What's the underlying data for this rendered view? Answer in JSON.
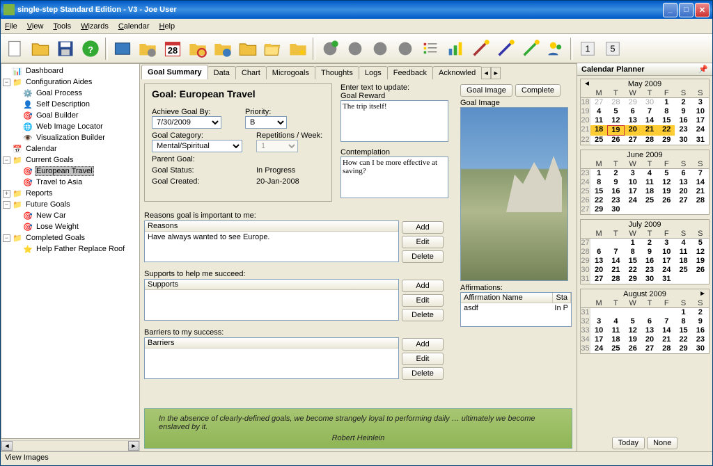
{
  "window": {
    "title": "single-step Standard Edition - V3 - Joe User"
  },
  "menu": [
    "File",
    "View",
    "Tools",
    "Wizards",
    "Calendar",
    "Help"
  ],
  "tree": {
    "dashboard": "Dashboard",
    "config_aides": "Configuration Aides",
    "goal_process": "Goal Process",
    "self_desc": "Self Description",
    "goal_builder": "Goal Builder",
    "web_img": "Web Image Locator",
    "viz_builder": "Visualization Builder",
    "calendar": "Calendar",
    "current_goals": "Current Goals",
    "european": "European Travel",
    "asia": "Travel to Asia",
    "reports": "Reports",
    "future_goals": "Future Goals",
    "new_car": "New Car",
    "lose_weight": "Lose Weight",
    "completed": "Completed Goals",
    "help_father": "Help Father Replace Roof"
  },
  "tabs": [
    "Goal Summary",
    "Data",
    "Chart",
    "Microgoals",
    "Thoughts",
    "Logs",
    "Feedback",
    "Acknowled"
  ],
  "goal": {
    "title": "Goal: European Travel",
    "achieve_by_lbl": "Achieve Goal By:",
    "achieve_by": "7/30/2009",
    "priority_lbl": "Priority:",
    "priority": "B",
    "category_lbl": "Goal Category:",
    "category": "Mental/Spiritual",
    "reps_lbl": "Repetitions / Week:",
    "reps": "1",
    "parent_lbl": "Parent Goal:",
    "status_lbl": "Goal Status:",
    "status": "In Progress",
    "created_lbl": "Goal Created:",
    "created": "20-Jan-2008"
  },
  "mid": {
    "enter_text": "Enter text to update:",
    "reward_lbl": "Goal Reward",
    "reward": "The trip itself!",
    "contemp_lbl": "Contemplation",
    "contemp": "How can I be more effective at saving?"
  },
  "right": {
    "goal_image_btn": "Goal Image",
    "complete_btn": "Complete",
    "goal_image_lbl": "Goal Image",
    "affirm_lbl": "Affirmations:",
    "aff_col1": "Affirmation Name",
    "aff_col2": "Sta",
    "aff_row1_name": "asdf",
    "aff_row1_status": "In P"
  },
  "sections": {
    "reasons_lbl": "Reasons goal is important to me:",
    "reasons_hdr": "Reasons",
    "reasons_body": "Have always wanted to see Europe.",
    "supports_lbl": "Supports to help me succeed:",
    "supports_hdr": "Supports",
    "barriers_lbl": "Barriers to my success:",
    "barriers_hdr": "Barriers",
    "add": "Add",
    "edit": "Edit",
    "delete": "Delete"
  },
  "quote": {
    "text": "In the absence of clearly-defined goals, we become strangely loyal to performing daily … ultimately we become enslaved by it.",
    "author": "Robert Heinlein"
  },
  "calendar": {
    "title": "Calendar Planner",
    "today": "Today",
    "none": "None",
    "dow": [
      "M",
      "T",
      "W",
      "T",
      "F",
      "S",
      "S"
    ],
    "months": [
      {
        "name": "May 2009",
        "weeks": [
          {
            "wn": "18",
            "days": [
              [
                "27",
                true
              ],
              [
                "28",
                true
              ],
              [
                "29",
                true
              ],
              [
                "30",
                true
              ],
              [
                "1",
                false
              ],
              [
                "2",
                false
              ],
              [
                "3",
                false
              ]
            ]
          },
          {
            "wn": "19",
            "days": [
              [
                "4",
                false
              ],
              [
                "5",
                false
              ],
              [
                "6",
                false
              ],
              [
                "7",
                false
              ],
              [
                "8",
                false
              ],
              [
                "9",
                false
              ],
              [
                "10",
                false
              ]
            ]
          },
          {
            "wn": "20",
            "days": [
              [
                "11",
                false
              ],
              [
                "12",
                false
              ],
              [
                "13",
                false
              ],
              [
                "14",
                false
              ],
              [
                "15",
                false
              ],
              [
                "16",
                false
              ],
              [
                "17",
                false
              ]
            ]
          },
          {
            "wn": "21",
            "days": [
              [
                "18",
                false,
                "hl"
              ],
              [
                "19",
                false,
                "hl today"
              ],
              [
                "20",
                false,
                "hl"
              ],
              [
                "21",
                false,
                "hl"
              ],
              [
                "22",
                false,
                "hl"
              ],
              [
                "23",
                false
              ],
              [
                "24",
                false
              ]
            ]
          },
          {
            "wn": "22",
            "days": [
              [
                "25",
                false
              ],
              [
                "26",
                false
              ],
              [
                "27",
                false
              ],
              [
                "28",
                false
              ],
              [
                "29",
                false
              ],
              [
                "30",
                false
              ],
              [
                "31",
                false
              ]
            ]
          }
        ]
      },
      {
        "name": "June 2009",
        "weeks": [
          {
            "wn": "23",
            "days": [
              [
                "1",
                false
              ],
              [
                "2",
                false
              ],
              [
                "3",
                false
              ],
              [
                "4",
                false
              ],
              [
                "5",
                false
              ],
              [
                "6",
                false
              ],
              [
                "7",
                false
              ]
            ]
          },
          {
            "wn": "24",
            "days": [
              [
                "8",
                false
              ],
              [
                "9",
                false
              ],
              [
                "10",
                false
              ],
              [
                "11",
                false
              ],
              [
                "12",
                false
              ],
              [
                "13",
                false
              ],
              [
                "14",
                false
              ]
            ]
          },
          {
            "wn": "25",
            "days": [
              [
                "15",
                false
              ],
              [
                "16",
                false
              ],
              [
                "17",
                false
              ],
              [
                "18",
                false
              ],
              [
                "19",
                false
              ],
              [
                "20",
                false
              ],
              [
                "21",
                false
              ]
            ]
          },
          {
            "wn": "26",
            "days": [
              [
                "22",
                false
              ],
              [
                "23",
                false
              ],
              [
                "24",
                false
              ],
              [
                "25",
                false
              ],
              [
                "26",
                false
              ],
              [
                "27",
                false
              ],
              [
                "28",
                false
              ]
            ]
          },
          {
            "wn": "27",
            "days": [
              [
                "29",
                false
              ],
              [
                "30",
                false
              ],
              [
                "",
                true
              ],
              [
                "",
                true
              ],
              [
                "",
                true
              ],
              [
                "",
                true
              ],
              [
                "",
                true
              ]
            ]
          }
        ]
      },
      {
        "name": "July 2009",
        "weeks": [
          {
            "wn": "27",
            "days": [
              [
                "",
                true
              ],
              [
                "",
                true
              ],
              [
                "1",
                false
              ],
              [
                "2",
                false
              ],
              [
                "3",
                false
              ],
              [
                "4",
                false
              ],
              [
                "5",
                false
              ]
            ]
          },
          {
            "wn": "28",
            "days": [
              [
                "6",
                false
              ],
              [
                "7",
                false
              ],
              [
                "8",
                false
              ],
              [
                "9",
                false
              ],
              [
                "10",
                false
              ],
              [
                "11",
                false
              ],
              [
                "12",
                false
              ]
            ]
          },
          {
            "wn": "29",
            "days": [
              [
                "13",
                false
              ],
              [
                "14",
                false
              ],
              [
                "15",
                false
              ],
              [
                "16",
                false
              ],
              [
                "17",
                false
              ],
              [
                "18",
                false
              ],
              [
                "19",
                false
              ]
            ]
          },
          {
            "wn": "30",
            "days": [
              [
                "20",
                false
              ],
              [
                "21",
                false
              ],
              [
                "22",
                false
              ],
              [
                "23",
                false
              ],
              [
                "24",
                false
              ],
              [
                "25",
                false
              ],
              [
                "26",
                false
              ]
            ]
          },
          {
            "wn": "31",
            "days": [
              [
                "27",
                false
              ],
              [
                "28",
                false
              ],
              [
                "29",
                false
              ],
              [
                "30",
                false
              ],
              [
                "31",
                false
              ],
              [
                "",
                true
              ],
              [
                "",
                true
              ]
            ]
          }
        ]
      },
      {
        "name": "August 2009",
        "weeks": [
          {
            "wn": "31",
            "days": [
              [
                "",
                true
              ],
              [
                "",
                true
              ],
              [
                "",
                true
              ],
              [
                "",
                true
              ],
              [
                "",
                true
              ],
              [
                "1",
                false
              ],
              [
                "2",
                false
              ]
            ]
          },
          {
            "wn": "32",
            "days": [
              [
                "3",
                false
              ],
              [
                "4",
                false
              ],
              [
                "5",
                false
              ],
              [
                "6",
                false
              ],
              [
                "7",
                false
              ],
              [
                "8",
                false
              ],
              [
                "9",
                false
              ]
            ]
          },
          {
            "wn": "33",
            "days": [
              [
                "10",
                false
              ],
              [
                "11",
                false
              ],
              [
                "12",
                false
              ],
              [
                "13",
                false
              ],
              [
                "14",
                false
              ],
              [
                "15",
                false
              ],
              [
                "16",
                false
              ]
            ]
          },
          {
            "wn": "34",
            "days": [
              [
                "17",
                false
              ],
              [
                "18",
                false
              ],
              [
                "19",
                false
              ],
              [
                "20",
                false
              ],
              [
                "21",
                false
              ],
              [
                "22",
                false
              ],
              [
                "23",
                false
              ]
            ]
          },
          {
            "wn": "35",
            "days": [
              [
                "24",
                false
              ],
              [
                "25",
                false
              ],
              [
                "26",
                false
              ],
              [
                "27",
                false
              ],
              [
                "28",
                false
              ],
              [
                "29",
                false
              ],
              [
                "30",
                false
              ]
            ]
          }
        ]
      }
    ]
  },
  "status": "View Images"
}
